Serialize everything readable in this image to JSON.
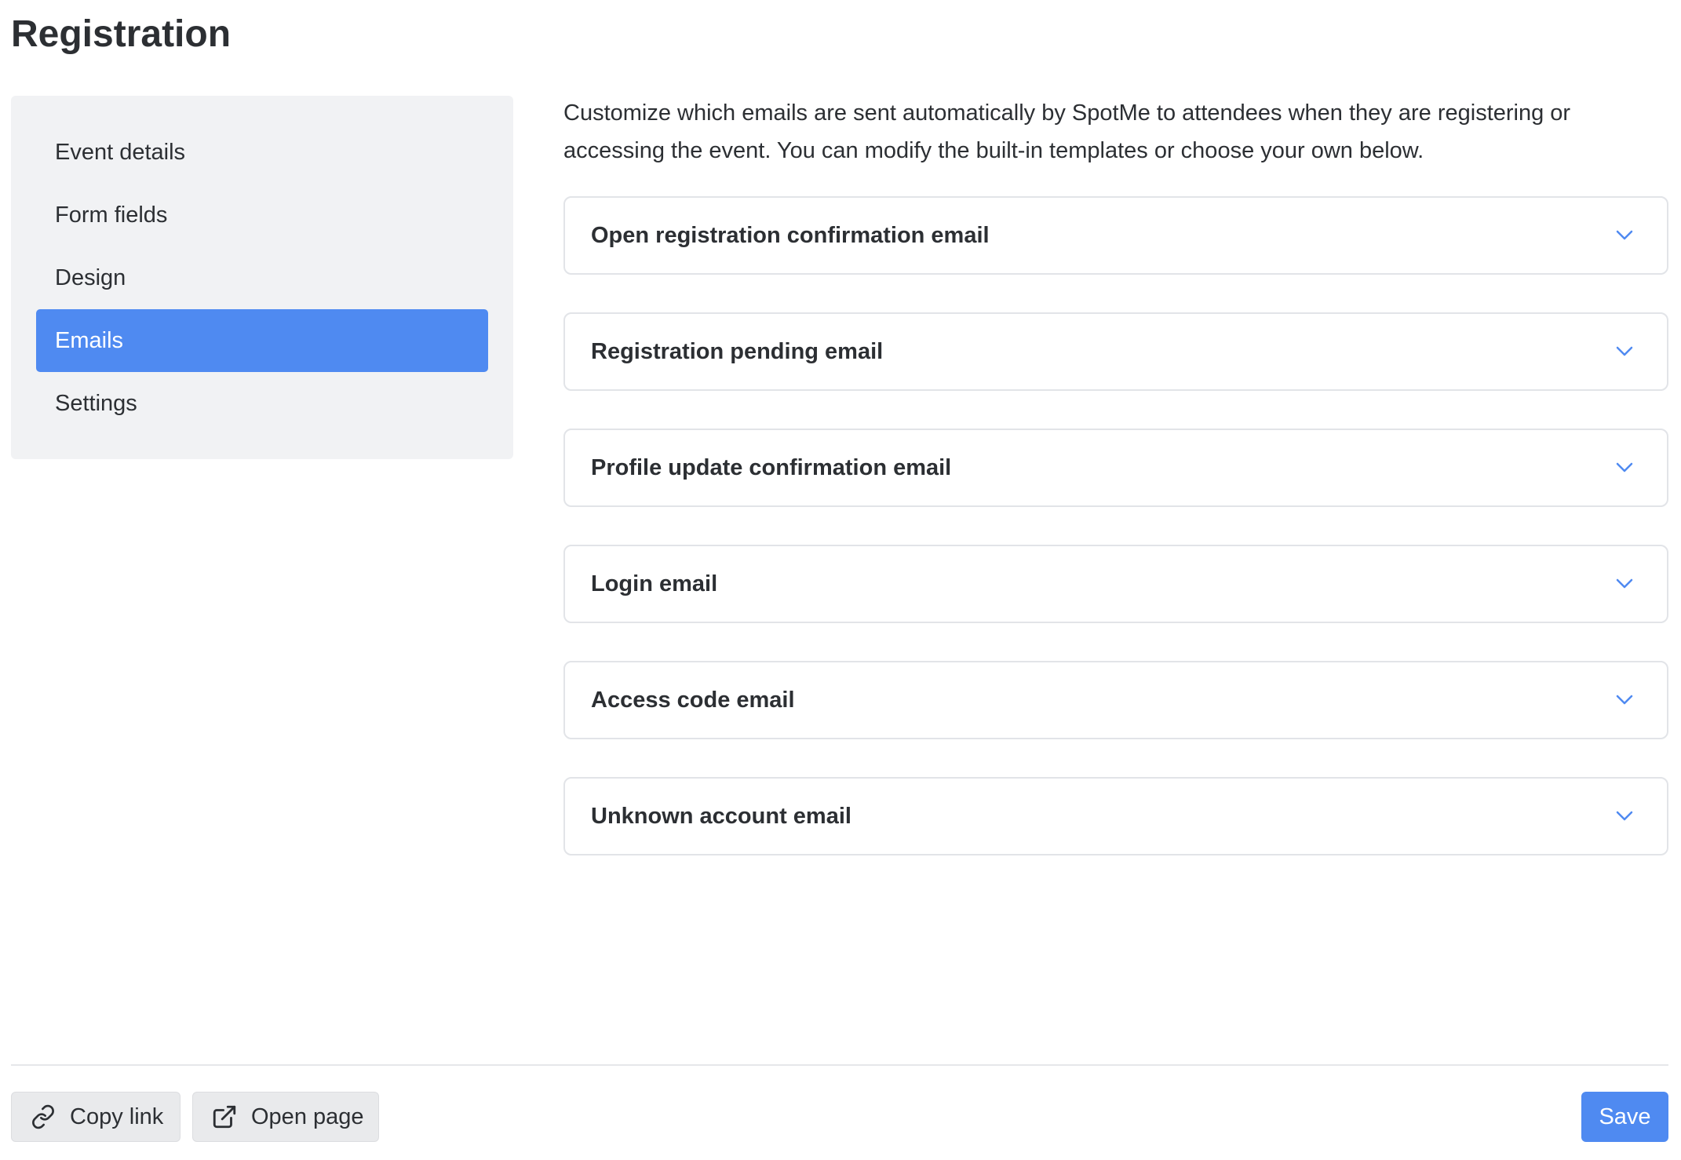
{
  "header": {
    "title": "Registration"
  },
  "sidebar": {
    "items": [
      {
        "label": "Event details",
        "active": false
      },
      {
        "label": "Form fields",
        "active": false
      },
      {
        "label": "Design",
        "active": false
      },
      {
        "label": "Emails",
        "active": true
      },
      {
        "label": "Settings",
        "active": false
      }
    ]
  },
  "main": {
    "description": "Customize which emails are sent automatically by SpotMe to attendees when they are registering or accessing the event. You can modify the built-in templates or choose your own below.",
    "emails": [
      {
        "label": "Open registration confirmation email"
      },
      {
        "label": "Registration pending email"
      },
      {
        "label": "Profile update confirmation email"
      },
      {
        "label": "Login email"
      },
      {
        "label": "Access code email"
      },
      {
        "label": "Unknown account email"
      }
    ]
  },
  "footer": {
    "copy_link_label": "Copy link",
    "open_page_label": "Open page",
    "save_label": "Save"
  },
  "icons": {
    "copy_link": "link-icon",
    "open_page": "external-link-icon",
    "accordion": "chevron-down-icon"
  },
  "colors": {
    "accent": "#4f8af1",
    "sidebar_bg": "#f1f2f4",
    "text": "#2c2f33",
    "border": "#e2e4e8"
  }
}
